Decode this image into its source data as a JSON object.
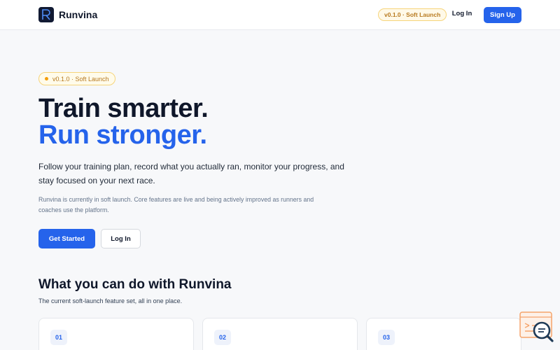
{
  "header": {
    "brand": "Runvina",
    "logo_letter": "R",
    "version_badge": "v0.1.0 · Soft Launch",
    "login_label": "Log In",
    "signup_label": "Sign Up"
  },
  "hero": {
    "badge": "v0.1.0 · Soft Launch",
    "title_line1": "Train smarter.",
    "title_line2": "Run stronger.",
    "lead": "Follow your training plan, record what you actually ran, monitor your progress, and stay focused on your next race.",
    "note": "Runvina is currently in soft launch. Core features are live and being actively improved as runners and coaches use the platform.",
    "primary_cta": "Get Started",
    "secondary_cta": "Log In"
  },
  "features": {
    "title": "What you can do with Runvina",
    "subtitle": "The current soft-launch feature set, all in one place.",
    "cards": [
      {
        "number": "01"
      },
      {
        "number": "02"
      },
      {
        "number": "03"
      }
    ]
  },
  "colors": {
    "accent": "#2563eb",
    "badge_text": "#b7791f",
    "dark": "#0f172a",
    "widget": "#f5a46b"
  },
  "icons": {
    "logo": "runvina-logo-icon",
    "assistant": "chat-search-icon"
  }
}
